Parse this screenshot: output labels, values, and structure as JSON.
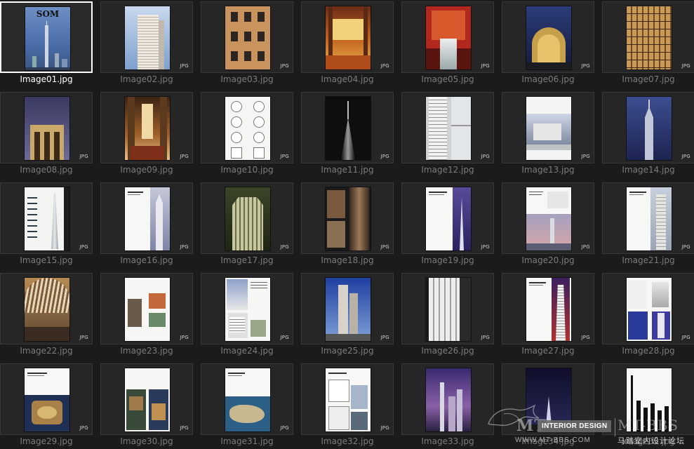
{
  "files": [
    {
      "name": "Image01.jpg",
      "badge": "",
      "selected": true,
      "thumb": "cover"
    },
    {
      "name": "Image02.jpg",
      "badge": "JPG",
      "selected": false,
      "thumb": "tower-day"
    },
    {
      "name": "Image03.jpg",
      "badge": "JPG",
      "selected": false,
      "thumb": "facade-warm"
    },
    {
      "name": "Image04.jpg",
      "badge": "JPG",
      "selected": false,
      "thumb": "interior-gold"
    },
    {
      "name": "Image05.jpg",
      "badge": "JPG",
      "selected": false,
      "thumb": "lobby-red"
    },
    {
      "name": "Image06.jpg",
      "badge": "JPG",
      "selected": false,
      "thumb": "arch-night"
    },
    {
      "name": "Image07.jpg",
      "badge": "JPG",
      "selected": false,
      "thumb": "facade-gold"
    },
    {
      "name": "Image08.jpg",
      "badge": "JPG",
      "selected": false,
      "thumb": "entrance-purple"
    },
    {
      "name": "Image09.jpg",
      "badge": "JPG",
      "selected": false,
      "thumb": "atrium-warm"
    },
    {
      "name": "Image10.jpg",
      "badge": "JPG",
      "selected": false,
      "thumb": "plans-white"
    },
    {
      "name": "Image11.jpg",
      "badge": "JPG",
      "selected": false,
      "thumb": "spire-dark"
    },
    {
      "name": "Image12.jpg",
      "badge": "JPG",
      "selected": false,
      "thumb": "tower-white"
    },
    {
      "name": "Image13.jpg",
      "badge": "JPG",
      "selected": false,
      "thumb": "page-photo-top"
    },
    {
      "name": "Image14.jpg",
      "badge": "JPG",
      "selected": false,
      "thumb": "tower-night-blue"
    },
    {
      "name": "Image15.jpg",
      "badge": "JPG",
      "selected": false,
      "thumb": "drawings-tower"
    },
    {
      "name": "Image16.jpg",
      "badge": "JPG",
      "selected": false,
      "thumb": "text-tower-right"
    },
    {
      "name": "Image17.jpg",
      "badge": "JPG",
      "selected": false,
      "thumb": "tower-crown-green"
    },
    {
      "name": "Image18.jpg",
      "badge": "JPG",
      "selected": false,
      "thumb": "collage-dark"
    },
    {
      "name": "Image19.jpg",
      "badge": "JPG",
      "selected": false,
      "thumb": "text-tower-purple"
    },
    {
      "name": "Image20.jpg",
      "badge": "JPG",
      "selected": false,
      "thumb": "text-skyline-pink"
    },
    {
      "name": "Image21.jpg",
      "badge": "JPG",
      "selected": false,
      "thumb": "text-tower-day"
    },
    {
      "name": "Image22.jpg",
      "badge": "JPG",
      "selected": false,
      "thumb": "vault-interior"
    },
    {
      "name": "Image23.jpg",
      "badge": "JPG",
      "selected": false,
      "thumb": "spread-map"
    },
    {
      "name": "Image24.jpg",
      "badge": "JPG",
      "selected": false,
      "thumb": "spread-buildings"
    },
    {
      "name": "Image25.jpg",
      "badge": "JPG",
      "selected": false,
      "thumb": "towers-blue-sky"
    },
    {
      "name": "Image26.jpg",
      "badge": "JPG",
      "selected": false,
      "thumb": "facade-white-grid"
    },
    {
      "name": "Image27.jpg",
      "badge": "JPG",
      "selected": false,
      "thumb": "text-tower-red"
    },
    {
      "name": "Image28.jpg",
      "badge": "JPG",
      "selected": false,
      "thumb": "spread-models"
    },
    {
      "name": "Image29.jpg",
      "badge": "JPG",
      "selected": false,
      "thumb": "text-plaza-aerial"
    },
    {
      "name": "Image30.jpg",
      "badge": "JPG",
      "selected": false,
      "thumb": "spread-aerials"
    },
    {
      "name": "Image31.jpg",
      "badge": "JPG",
      "selected": false,
      "thumb": "text-island-aerial"
    },
    {
      "name": "Image32.jpg",
      "badge": "JPG",
      "selected": false,
      "thumb": "text-plans-photos"
    },
    {
      "name": "Image33.jpg",
      "badge": "",
      "selected": false,
      "thumb": "towers-violet"
    },
    {
      "name": "Image34.jpg",
      "badge": "",
      "selected": false,
      "thumb": "night-fountain"
    },
    {
      "name": "Image35.jpg",
      "badge": "",
      "selected": false,
      "thumb": "elevations"
    }
  ],
  "watermark": {
    "brand": "MT",
    "chip": "INTERIOR DESIGN",
    "brand2": "MT-BBS",
    "site": "WWW.MT-BBS.COM",
    "cn": "马踏室内设计论坛"
  }
}
